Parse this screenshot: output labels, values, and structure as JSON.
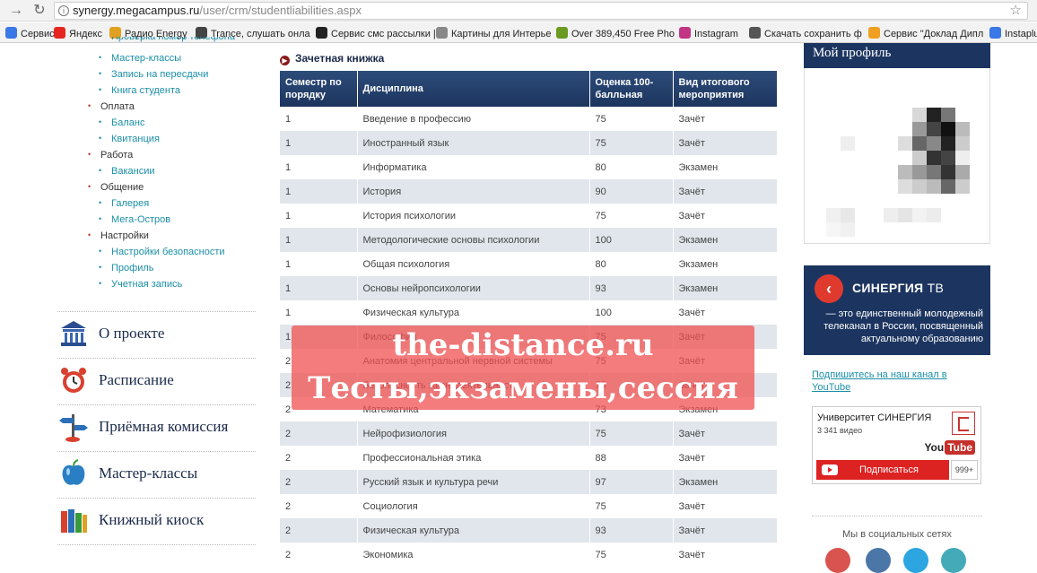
{
  "browser": {
    "url_host": "synergy.megacampus.ru",
    "url_path": "/user/crm/studentliabilities.aspx",
    "bookmarks": [
      {
        "label": "Сервисы",
        "icon": "apps-icon",
        "color": "#3b78e7"
      },
      {
        "label": "Яндекс",
        "icon": "yandex-icon",
        "color": "#e52620"
      },
      {
        "label": "Радио Energy",
        "icon": "radio-icon",
        "color": "#e0a020"
      },
      {
        "label": "Trance, слушать онла",
        "icon": "play-icon",
        "color": "#444444"
      },
      {
        "label": "Сервис смс рассылки |",
        "icon": "sms-icon",
        "color": "#222222"
      },
      {
        "label": "Картины для Интерье",
        "icon": "thumb-icon",
        "color": "#888888"
      },
      {
        "label": "Over 389,450 Free Pho",
        "icon": "photo-icon",
        "color": "#6a9a1f"
      },
      {
        "label": "Instagram",
        "icon": "instagram-icon",
        "color": "#c13584"
      },
      {
        "label": "Скачать сохранить ф",
        "icon": "download-icon",
        "color": "#555555"
      },
      {
        "label": "Сервис \"Доклад Дипл",
        "icon": "doc-icon",
        "color": "#f0a020"
      },
      {
        "label": "Instaplu",
        "icon": "instaplus-icon",
        "color": "#3b78e7"
      }
    ]
  },
  "sidebar": {
    "top_cut": "Проверка номер телефона",
    "items": [
      {
        "label": "Мастер-классы",
        "type": "sub"
      },
      {
        "label": "Запись на пересдачи",
        "type": "sub"
      },
      {
        "label": "Книга студента",
        "type": "sub"
      },
      {
        "label": "Оплата",
        "type": "group"
      },
      {
        "label": "Баланс",
        "type": "sub"
      },
      {
        "label": "Квитанция",
        "type": "sub"
      },
      {
        "label": "Работа",
        "type": "group"
      },
      {
        "label": "Вакансии",
        "type": "sub"
      },
      {
        "label": "Общение",
        "type": "group"
      },
      {
        "label": "Галерея",
        "type": "sub"
      },
      {
        "label": "Мега-Остров",
        "type": "sub"
      },
      {
        "label": "Настройки",
        "type": "group"
      },
      {
        "label": "Настройки безопасности",
        "type": "sub"
      },
      {
        "label": "Профиль",
        "type": "sub"
      },
      {
        "label": "Учетная запись",
        "type": "sub"
      }
    ],
    "nav": [
      {
        "label": "О проекте",
        "icon": "museum-icon"
      },
      {
        "label": "Расписание",
        "icon": "alarm-clock-icon"
      },
      {
        "label": "Приёмная комиссия",
        "icon": "signpost-icon"
      },
      {
        "label": "Мастер-классы",
        "icon": "apple-icon"
      },
      {
        "label": "Книжный киоск",
        "icon": "books-icon"
      }
    ]
  },
  "main": {
    "section_title": "Зачетная книжка",
    "columns": [
      "Семестр по порядку",
      "Дисциплина",
      "Оценка 100-балльная",
      "Вид итогового мероприятия"
    ],
    "rows": [
      [
        "1",
        "Введение в профессию",
        "75",
        "Зачёт"
      ],
      [
        "1",
        "Иностранный язык",
        "75",
        "Зачёт"
      ],
      [
        "1",
        "Информатика",
        "80",
        "Экзамен"
      ],
      [
        "1",
        "История",
        "90",
        "Зачёт"
      ],
      [
        "1",
        "История психологии",
        "75",
        "Зачёт"
      ],
      [
        "1",
        "Методологические основы психологии",
        "100",
        "Экзамен"
      ],
      [
        "1",
        "Общая психология",
        "80",
        "Экзамен"
      ],
      [
        "1",
        "Основы нейропсихологии",
        "93",
        "Экзамен"
      ],
      [
        "1",
        "Физическая культура",
        "100",
        "Зачёт"
      ],
      [
        "1",
        "Философия",
        "75",
        "Зачёт"
      ],
      [
        "2",
        "Анатомия центральной нервной системы",
        "75",
        "Зачёт"
      ],
      [
        "2",
        "Безопасность жизнедеятельности",
        "75",
        "Зачёт"
      ],
      [
        "2",
        "Математика",
        "73",
        "Экзамен"
      ],
      [
        "2",
        "Нейрофизиология",
        "75",
        "Зачёт"
      ],
      [
        "2",
        "Профессиональная этика",
        "88",
        "Зачёт"
      ],
      [
        "2",
        "Русский язык и культура речи",
        "97",
        "Экзамен"
      ],
      [
        "2",
        "Социология",
        "75",
        "Зачёт"
      ],
      [
        "2",
        "Физическая культура",
        "93",
        "Зачёт"
      ],
      [
        "2",
        "Экономика",
        "75",
        "Зачёт"
      ]
    ]
  },
  "watermark": {
    "line1": "the-distance.ru",
    "line2": "Тесты,экзамены,сессия"
  },
  "right": {
    "profile_title": "Мой профиль",
    "tv_brand": "СИНЕРГИЯ",
    "tv_suffix": "ТВ",
    "tv_desc": "— это единственный молодежный телеканал в России, посвященный актуальному образованию",
    "yt_link": "Подпишитесь на наш канал в YouTube",
    "yt_channel": "Университет СИНЕРГИЯ",
    "yt_videos": "3 341 видео",
    "yt_subscribe": "Подписаться",
    "yt_count": "999+",
    "social_label": "Мы в социальных сетях",
    "social_colors": [
      "#d9534f",
      "#4a76a8",
      "#2ca5e0",
      "#45aab8"
    ]
  },
  "colors": {
    "accent_dark": "#1c3560",
    "link": "#1a8fa8",
    "row_alt": "#e1e6ec",
    "watermark": "#f05050"
  }
}
